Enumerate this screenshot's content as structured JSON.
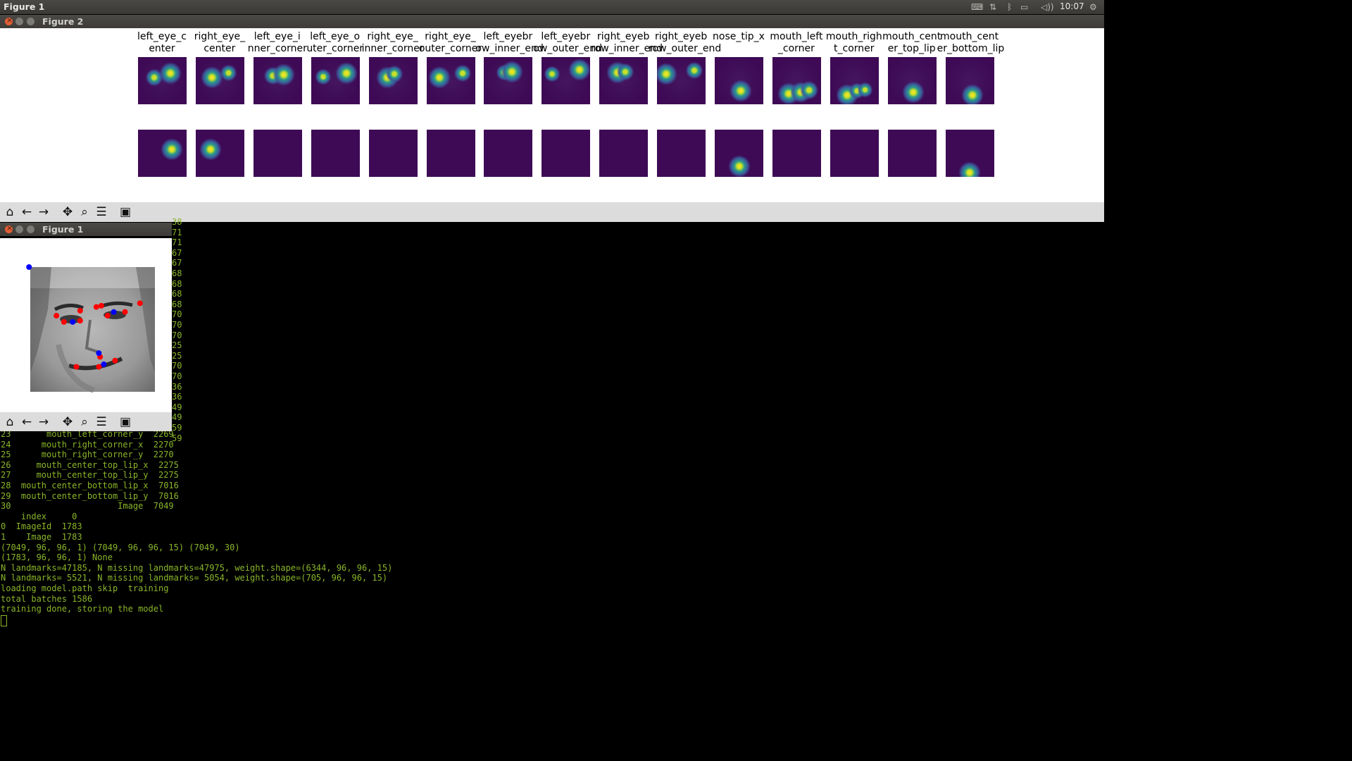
{
  "panel": {
    "app_title": "Figure 1",
    "clock": "10:07",
    "indicators": [
      "keyboard-icon",
      "network-icon",
      "bluetooth-icon",
      "battery-icon",
      "volume-icon",
      "settings-icon"
    ]
  },
  "figure2": {
    "window_title": "Figure 2",
    "labels": [
      "left_eye_c\nenter",
      "right_eye_\ncenter",
      "left_eye_i\nnner_corner",
      "left_eye_o\nuter_corner",
      "right_eye_\ninner_corner",
      "right_eye_\nouter_corner",
      "left_eyebr\now_inner_end",
      "left_eyebr\now_outer_end",
      "right_eyeb\nrow_inner_end",
      "right_eyeb\nrow_outer_end",
      "nose_tip_x",
      "mouth_left\n_corner",
      "mouth_righ\nt_corner",
      "mouth_cent\ner_top_lip",
      "mouth_cent\ner_bottom_lip"
    ],
    "colormap": {
      "background": "#3e0a55",
      "low": "#3a5d9c",
      "mid": "#2a9b8a",
      "high": "#c8e02a",
      "peak": "#fde725"
    },
    "predicted_heatmaps": [
      [
        [
          0.33,
          0.43,
          0.6
        ],
        [
          0.67,
          0.35,
          1
        ]
      ],
      [
        [
          0.33,
          0.43,
          1
        ],
        [
          0.68,
          0.33,
          0.55
        ]
      ],
      [
        [
          0.4,
          0.4,
          0.65
        ],
        [
          0.62,
          0.37,
          1
        ]
      ],
      [
        [
          0.25,
          0.42,
          0.5
        ],
        [
          0.73,
          0.35,
          1
        ]
      ],
      [
        [
          0.38,
          0.43,
          1
        ],
        [
          0.53,
          0.36,
          0.6
        ]
      ],
      [
        [
          0.27,
          0.44,
          1
        ],
        [
          0.75,
          0.34,
          0.6
        ]
      ],
      [
        [
          0.42,
          0.33,
          0.5
        ],
        [
          0.57,
          0.31,
          1
        ]
      ],
      [
        [
          0.21,
          0.36,
          0.5
        ],
        [
          0.78,
          0.27,
          1
        ]
      ],
      [
        [
          0.38,
          0.33,
          1
        ],
        [
          0.54,
          0.31,
          0.6
        ]
      ],
      [
        [
          0.18,
          0.36,
          1
        ],
        [
          0.77,
          0.28,
          0.6
        ]
      ],
      [
        [
          0.54,
          0.71,
          1
        ]
      ],
      [
        [
          0.33,
          0.77,
          1
        ],
        [
          0.58,
          0.75,
          0.9
        ],
        [
          0.75,
          0.7,
          0.7
        ]
      ],
      [
        [
          0.35,
          0.8,
          1
        ],
        [
          0.55,
          0.72,
          0.5
        ],
        [
          0.72,
          0.7,
          0.45
        ]
      ],
      [
        [
          0.53,
          0.75,
          1
        ]
      ],
      [
        [
          0.55,
          0.8,
          1
        ]
      ]
    ],
    "target_heatmaps": [
      [
        [
          0.7,
          0.42,
          1
        ]
      ],
      [
        [
          0.3,
          0.42,
          1
        ]
      ],
      [],
      [],
      [],
      [],
      [],
      [],
      [],
      [],
      [
        [
          0.5,
          0.77,
          1
        ]
      ],
      [],
      [],
      [],
      [
        [
          0.5,
          0.91,
          1
        ]
      ]
    ]
  },
  "figure1": {
    "window_title": "Figure 1",
    "predicted_points_color": "#ff0000",
    "true_points_color": "#0000ff",
    "red_points": [
      [
        0.21,
        0.39
      ],
      [
        0.27,
        0.44
      ],
      [
        0.4,
        0.35
      ],
      [
        0.4,
        0.43
      ],
      [
        0.57,
        0.31
      ],
      [
        0.76,
        0.36
      ],
      [
        0.62,
        0.39
      ],
      [
        0.88,
        0.29
      ],
      [
        0.53,
        0.32
      ],
      [
        0.37,
        0.8
      ],
      [
        0.68,
        0.75
      ],
      [
        0.55,
        0.8
      ],
      [
        0.56,
        0.72
      ]
    ],
    "blue_points": [
      [
        -0.01,
        0.0
      ],
      [
        0.34,
        0.44
      ],
      [
        0.67,
        0.36
      ],
      [
        0.55,
        0.69
      ],
      [
        0.59,
        0.78
      ]
    ]
  },
  "toolbar": {
    "buttons": [
      {
        "name": "home-icon",
        "glyph": "⌂"
      },
      {
        "name": "back-icon",
        "glyph": "←"
      },
      {
        "name": "forward-icon",
        "glyph": "→"
      },
      {
        "name": "pan-icon",
        "glyph": "✥"
      },
      {
        "name": "zoom-icon",
        "glyph": "⌕"
      },
      {
        "name": "configure-subplots-icon",
        "glyph": "☰"
      },
      {
        "name": "save-icon",
        "glyph": "▣"
      }
    ]
  },
  "terminal": {
    "edge_fragments": [
      "38",
      "71",
      "71",
      "67",
      "67",
      "68",
      "68",
      "68",
      "68",
      "70",
      "70",
      "70",
      "25",
      "25",
      "70",
      "70",
      "36",
      "36",
      "49",
      "49",
      "59",
      "59"
    ],
    "lines": [
      "23       mouth_left_corner_y  2269",
      "24      mouth_right_corner_x  2270",
      "25      mouth_right_corner_y  2270",
      "26     mouth_center_top_lip_x  2275",
      "27     mouth_center_top_lip_y  2275",
      "28  mouth_center_bottom_lip_x  7016",
      "29  mouth_center_bottom_lip_y  7016",
      "30                     Image  7049",
      "    index     0",
      "0  ImageId  1783",
      "1    Image  1783",
      "(7049, 96, 96, 1) (7049, 96, 96, 15) (7049, 30)",
      "(1783, 96, 96, 1) None",
      "N landmarks=47185, N missing landmarks=47975, weight.shape=(6344, 96, 96, 15)",
      "N landmarks= 5521, N missing landmarks= 5054, weight.shape=(705, 96, 96, 15)",
      "loading model.path skip  training",
      "total batches 1586",
      "training done, storing the model"
    ]
  }
}
